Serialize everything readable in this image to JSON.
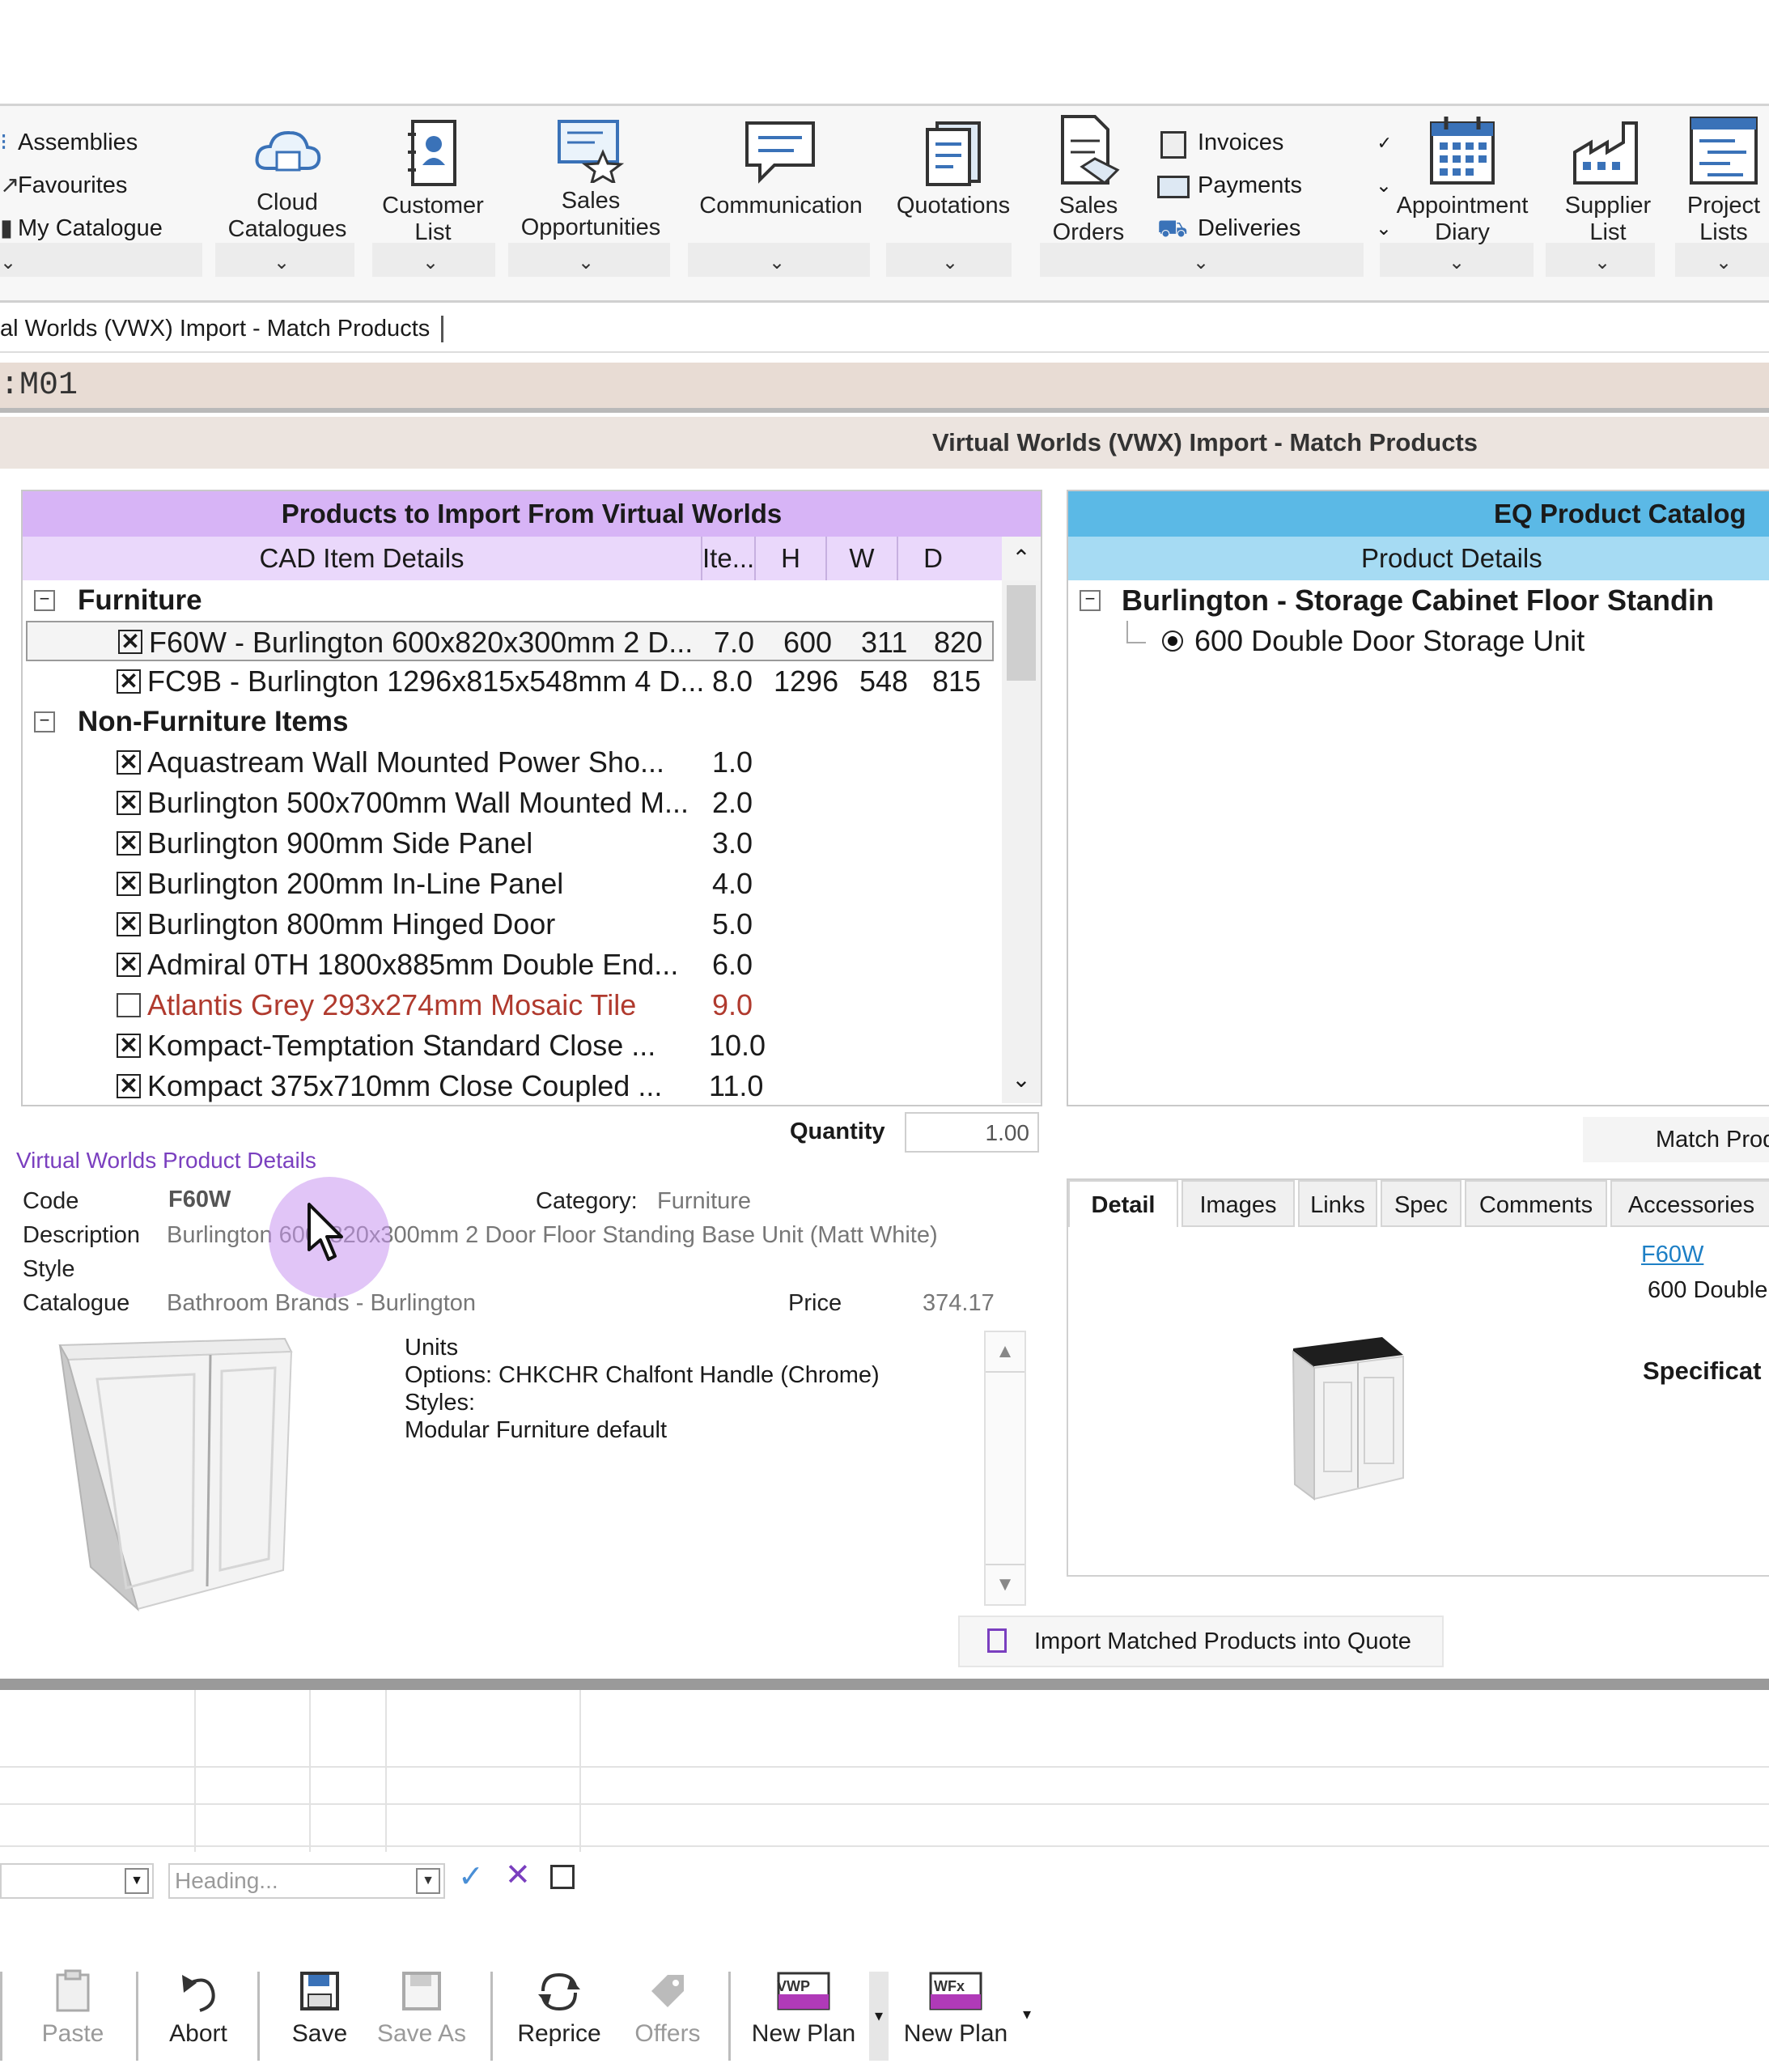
{
  "ribbon": {
    "catalogue_links": [
      "Assemblies",
      "Favourites",
      "My Catalogue"
    ],
    "buttons": {
      "cloud_catalogues": "Cloud\nCatalogues",
      "customer_list": "Customer\nList",
      "sales_opportunities": "Sales\nOpportunities",
      "communication": "Communication",
      "quotations": "Quotations",
      "sales_orders": "Sales\nOrders",
      "appointment_diary": "Appointment\nDiary",
      "supplier_list": "Supplier\nList",
      "project_lists": "Project\nLists"
    },
    "finance_links": [
      "Invoices",
      "Payments",
      "Deliveries"
    ]
  },
  "tab_title": "al Worlds (VWX) Import - Match Products",
  "code_bar": ":M01",
  "window_title": "Virtual Worlds (VWX) Import - Match Products",
  "left_panel": {
    "title": "Products to Import From Virtual Worlds",
    "columns": [
      "CAD Item Details",
      "Ite...",
      "H",
      "W",
      "D"
    ],
    "groups": [
      {
        "name": "Furniture",
        "items": [
          {
            "label": "F60W - Burlington 600x820x300mm 2 D...",
            "item": "7.0",
            "h": "600",
            "w": "311",
            "d": "820",
            "checked": true,
            "selected": true,
            "error": false
          },
          {
            "label": "FC9B - Burlington 1296x815x548mm 4 D...",
            "item": "8.0",
            "h": "1296",
            "w": "548",
            "d": "815",
            "checked": true,
            "selected": false,
            "error": false
          }
        ]
      },
      {
        "name": "Non-Furniture Items",
        "items": [
          {
            "label": "Aquastream Wall Mounted Power Sho...",
            "item": "1.0",
            "checked": true,
            "error": false
          },
          {
            "label": "Burlington 500x700mm Wall Mounted M...",
            "item": "2.0",
            "checked": true,
            "error": false
          },
          {
            "label": "Burlington 900mm Side Panel",
            "item": "3.0",
            "checked": true,
            "error": false
          },
          {
            "label": "Burlington 200mm In-Line Panel",
            "item": "4.0",
            "checked": true,
            "error": false
          },
          {
            "label": "Burlington 800mm Hinged Door",
            "item": "5.0",
            "checked": true,
            "error": false
          },
          {
            "label": "Admiral 0TH 1800x885mm Double End...",
            "item": "6.0",
            "checked": true,
            "error": false
          },
          {
            "label": "Atlantis Grey 293x274mm Mosaic Tile",
            "item": "9.0",
            "checked": false,
            "error": true
          },
          {
            "label": "Kompact-Temptation Standard Close ...",
            "item": "10.0",
            "checked": true,
            "error": false
          },
          {
            "label": "Kompact 375x710mm Close Coupled ...",
            "item": "11.0",
            "checked": true,
            "error": false
          }
        ]
      }
    ],
    "quantity_label": "Quantity",
    "quantity_value": "1.00"
  },
  "right_panel": {
    "title": "EQ Product Catalog",
    "subheader": "Product Details",
    "group": "Burlington - Storage Cabinet Floor Standin",
    "item": "600 Double Door Storage Unit",
    "match_button": "Match Prod",
    "tabs": [
      "Detail",
      "Images",
      "Links",
      "Spec",
      "Comments",
      "Accessories"
    ],
    "detail_link": "F60W",
    "detail_text": "600 Double",
    "spec_label": "Specificat"
  },
  "product_details": {
    "section_title": "Virtual Worlds Product Details",
    "code_label": "Code",
    "code": "F60W",
    "category_label": "Category:",
    "category": "Furniture",
    "description_label": "Description",
    "description": "Burlington 600x820x300mm 2 Door Floor Standing Base Unit (Matt White)",
    "style_label": "Style",
    "catalogue_label": "Catalogue",
    "catalogue": "Bathroom Brands - Burlington",
    "price_label": "Price",
    "price": "374.17",
    "notes": [
      "Units",
      "Options: CHKCHR Chalfont Handle (Chrome)",
      "Styles:",
      "Modular Furniture default"
    ]
  },
  "import_button": "Import Matched Products into Quote",
  "heading_placeholder": "Heading...",
  "toolbar": {
    "paste": "Paste",
    "abort": "Abort",
    "save": "Save",
    "save_as": "Save As",
    "reprice": "Reprice",
    "offers": "Offers",
    "new_plan_1": "New Plan",
    "new_plan_2": "New Plan",
    "vwp_badge": "VWP",
    "wfx_badge": "WFx"
  },
  "colors": {
    "purple_header": "#d7b4f6",
    "blue_header": "#5bb9e6",
    "error_text": "#b03a2e",
    "link": "#1d7fc5"
  }
}
